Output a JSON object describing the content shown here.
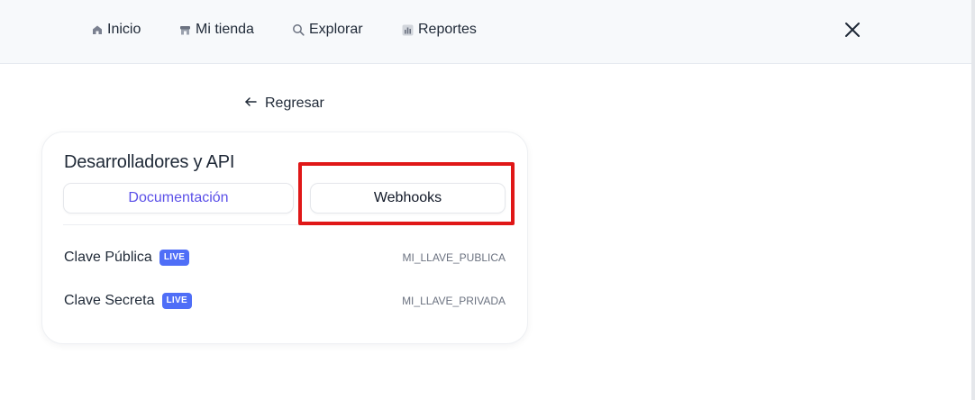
{
  "nav": {
    "items": [
      {
        "label": "Inicio",
        "icon": "home-icon"
      },
      {
        "label": "Mi tienda",
        "icon": "store-icon"
      },
      {
        "label": "Explorar",
        "icon": "search-icon"
      },
      {
        "label": "Reportes",
        "icon": "reports-icon"
      }
    ],
    "close_icon": "close-icon"
  },
  "back": {
    "label": "Regresar",
    "icon": "arrow-left-icon"
  },
  "card": {
    "title": "Desarrolladores y API",
    "tabs": [
      {
        "label": "Documentación",
        "color": "#5b50e8"
      },
      {
        "label": "Webhooks",
        "color": "#111827"
      }
    ],
    "keys": [
      {
        "label": "Clave Pública",
        "badge": "LIVE",
        "value": "MI_LLAVE_PUBLICA"
      },
      {
        "label": "Clave Secreta",
        "badge": "LIVE",
        "value": "MI_LLAVE_PRIVADA"
      }
    ]
  },
  "colors": {
    "accent": "#5b50e8",
    "badge": "#4f6ef7",
    "highlight": "#e01717"
  }
}
